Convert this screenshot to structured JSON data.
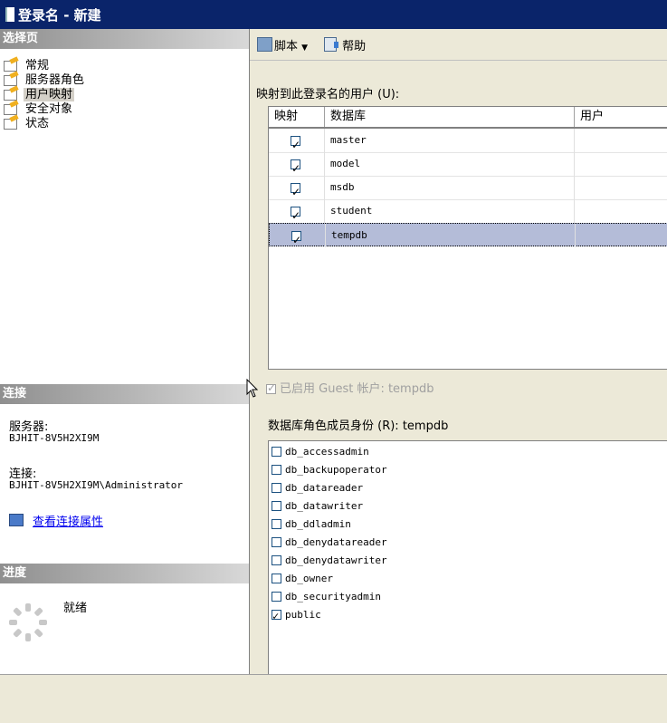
{
  "window": {
    "title": "登录名 - 新建"
  },
  "left": {
    "select_page_header": "选择页",
    "pages": [
      {
        "label": "常规"
      },
      {
        "label": "服务器角色"
      },
      {
        "label": "用户映射"
      },
      {
        "label": "安全对象"
      },
      {
        "label": "状态"
      }
    ],
    "connection_header": "连接",
    "server_label": "服务器:",
    "server_value": "BJHIT-8V5H2XI9M",
    "connection_label": "连接:",
    "connection_value": "BJHIT-8V5H2XI9M\\Administrator",
    "view_props_link": "查看连接属性",
    "progress_header": "进度",
    "progress_status": "就绪"
  },
  "toolbar": {
    "script_label": "脚本",
    "help_label": "帮助"
  },
  "mapping": {
    "label": "映射到此登录名的用户 (U):",
    "columns": [
      "映射",
      "数据库",
      "用户"
    ],
    "rows": [
      {
        "map": true,
        "db": "master",
        "user": ""
      },
      {
        "map": true,
        "db": "model",
        "user": ""
      },
      {
        "map": true,
        "db": "msdb",
        "user": ""
      },
      {
        "map": true,
        "db": "student",
        "user": ""
      },
      {
        "map": true,
        "db": "tempdb",
        "user": "",
        "selected": true
      }
    ]
  },
  "guest": {
    "label": "已启用 Guest 帐户: tempdb",
    "checked": true
  },
  "roles": {
    "label": "数据库角色成员身份 (R): tempdb",
    "items": [
      {
        "name": "db_accessadmin",
        "checked": false
      },
      {
        "name": "db_backupoperator",
        "checked": false
      },
      {
        "name": "db_datareader",
        "checked": false
      },
      {
        "name": "db_datawriter",
        "checked": false
      },
      {
        "name": "db_ddladmin",
        "checked": false
      },
      {
        "name": "db_denydatareader",
        "checked": false
      },
      {
        "name": "db_denydatawriter",
        "checked": false
      },
      {
        "name": "db_owner",
        "checked": false
      },
      {
        "name": "db_securityadmin",
        "checked": false
      },
      {
        "name": "public",
        "checked": true
      }
    ]
  },
  "colors": {
    "title_bar": "#0a246a",
    "selection": "#b4bcd8",
    "link": "#0000ee"
  }
}
